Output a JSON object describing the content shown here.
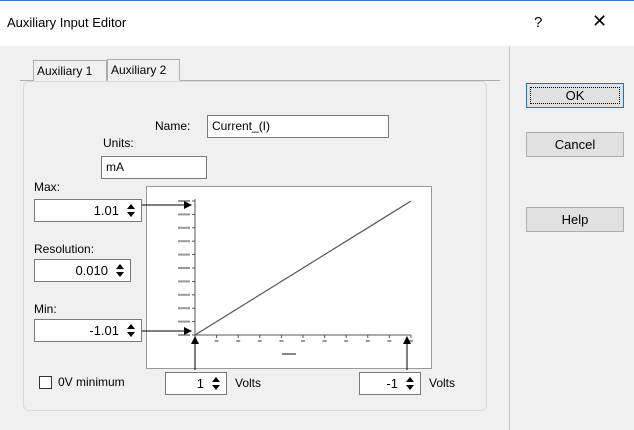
{
  "window": {
    "title": "Auxiliary Input Editor",
    "help_glyph": "?",
    "close_glyph": "✕"
  },
  "tabs": [
    {
      "label": "Auxiliary 1"
    },
    {
      "label": "Auxiliary 2"
    }
  ],
  "name": {
    "label": "Name:",
    "value": "Current_(I)"
  },
  "units": {
    "label": "Units:",
    "value": "mA"
  },
  "max": {
    "label": "Max:",
    "value": "1.01"
  },
  "resolution": {
    "label": "Resolution:",
    "value": "0.010"
  },
  "min": {
    "label": "Min:",
    "value": "-1.01"
  },
  "zero_min": {
    "label": "0V minimum",
    "checked": false
  },
  "volts_left": {
    "value": "1",
    "unit": "Volts"
  },
  "volts_right": {
    "value": "-1",
    "unit": "Volts"
  },
  "buttons": {
    "ok": "OK",
    "cancel": "Cancel",
    "help": "Help"
  },
  "icons": {
    "spin": "spin-arrows-icon",
    "arrow_right": "arrow-right-icon",
    "arrow_up": "arrow-up-icon"
  },
  "chart_data": {
    "type": "line",
    "series": [
      {
        "values": [
          [
            0,
            0
          ],
          [
            100,
            10000
          ]
        ]
      }
    ],
    "xlim": [
      0,
      100
    ],
    "ylim": [
      0,
      10000
    ],
    "grid": false
  }
}
